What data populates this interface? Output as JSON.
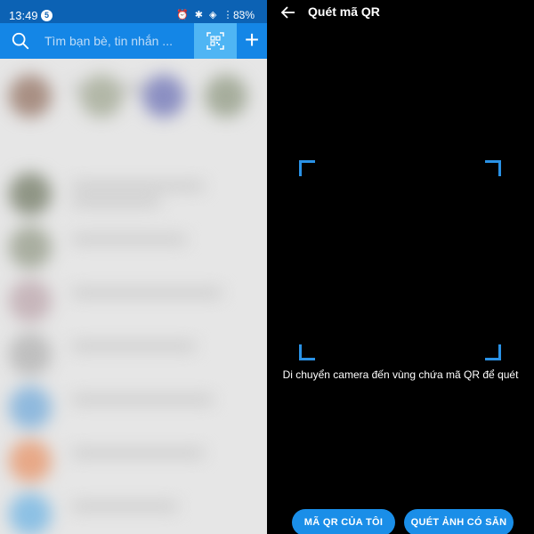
{
  "status_bar": {
    "time": "13:49",
    "notification_count": "5",
    "icons": "⏰ ✱ ◈ ⋮ ⫶",
    "battery": "83%"
  },
  "search": {
    "placeholder": "Tìm bạn bè, tin nhắn ..."
  },
  "plus_label": "+",
  "scanner": {
    "title": "Quét mã QR",
    "hint": "Di chuyển camera đến vùng chứa mã QR để quét",
    "my_qr_label": "MÃ QR CỦA TÔI",
    "scan_image_label": "QUÉT ẢNH CÓ SẴN"
  },
  "colors": {
    "accent": "#1486e6",
    "status_bar": "#0c62b4",
    "qr_highlight": "#4fb5f4",
    "frame": "#2a92e6",
    "button": "#1a8ee8"
  },
  "icons": {
    "search": "search-icon",
    "qr": "qr-code-icon",
    "plus": "plus-icon",
    "back": "arrow-left-icon"
  }
}
